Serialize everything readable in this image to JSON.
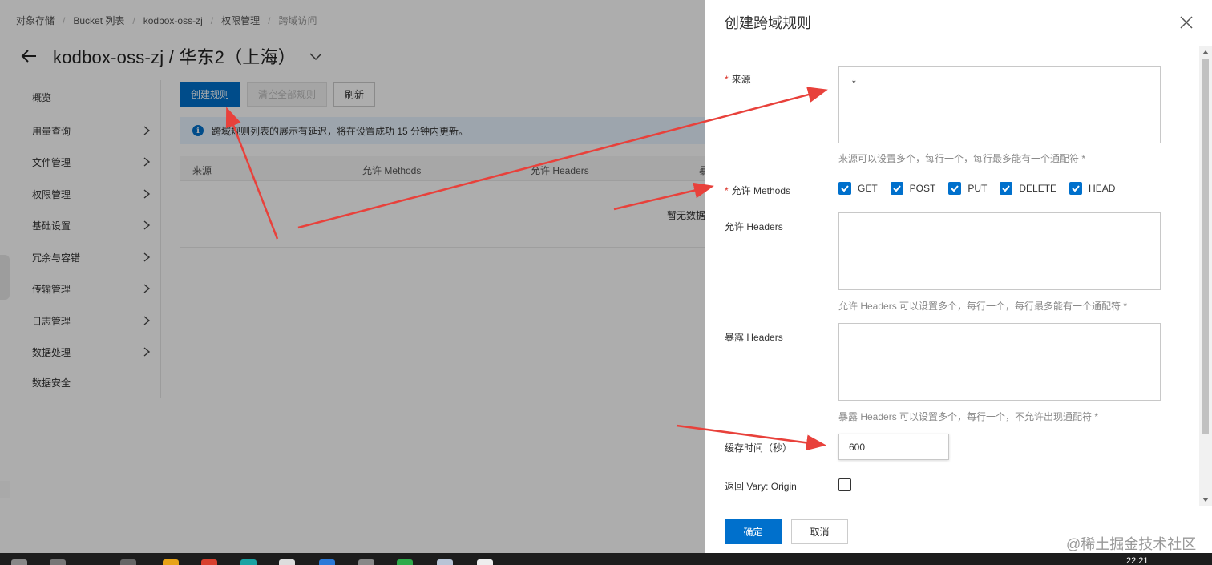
{
  "breadcrumb": [
    "对象存储",
    "Bucket 列表",
    "kodbox-oss-zj",
    "权限管理",
    "跨域访问"
  ],
  "page": {
    "title": "kodbox-oss-zj / 华东2（上海）"
  },
  "sidebar": {
    "items": [
      {
        "label": "概览",
        "has_arrow": false
      },
      {
        "label": "用量查询",
        "has_arrow": true
      },
      {
        "label": "文件管理",
        "has_arrow": true
      },
      {
        "label": "权限管理",
        "has_arrow": true
      },
      {
        "label": "基础设置",
        "has_arrow": true
      },
      {
        "label": "冗余与容错",
        "has_arrow": true
      },
      {
        "label": "传输管理",
        "has_arrow": true
      },
      {
        "label": "日志管理",
        "has_arrow": true
      },
      {
        "label": "数据处理",
        "has_arrow": true
      },
      {
        "label": "数据安全",
        "has_arrow": false
      }
    ]
  },
  "toolbar": {
    "create": "创建规则",
    "clear": "清空全部规则",
    "refresh": "刷新"
  },
  "notice": {
    "text": "跨域规则列表的展示有延迟，将在设置成功 15 分钟内更新。"
  },
  "table": {
    "columns": [
      "来源",
      "允许 Methods",
      "允许 Headers",
      "暴"
    ],
    "empty": "暂无数据"
  },
  "drawer": {
    "title": "创建跨域规则",
    "origin": {
      "label": "来源",
      "value": "*",
      "hint": "来源可以设置多个，每行一个，每行最多能有一个通配符 *"
    },
    "methods": {
      "label": "允许 Methods",
      "options": [
        "GET",
        "POST",
        "PUT",
        "DELETE",
        "HEAD"
      ],
      "checked": [
        true,
        true,
        true,
        true,
        true
      ]
    },
    "allow_headers": {
      "label": "允许 Headers",
      "value": "",
      "hint": "允许 Headers 可以设置多个，每行一个，每行最多能有一个通配符 *"
    },
    "expose_headers": {
      "label": "暴露 Headers",
      "value": "",
      "hint": "暴露 Headers 可以设置多个，每行一个，不允许出现通配符 *"
    },
    "cache": {
      "label": "缓存时间（秒）",
      "value": "600"
    },
    "vary": {
      "label": "返回 Vary: Origin",
      "checked": false
    },
    "confirm": "确定",
    "cancel": "取消"
  },
  "watermark": "@稀土掘金技术社区",
  "taskbar": {
    "clock": "22:21"
  },
  "colors": {
    "primary": "#0070cc",
    "annotation_arrow": "#e8413b"
  }
}
